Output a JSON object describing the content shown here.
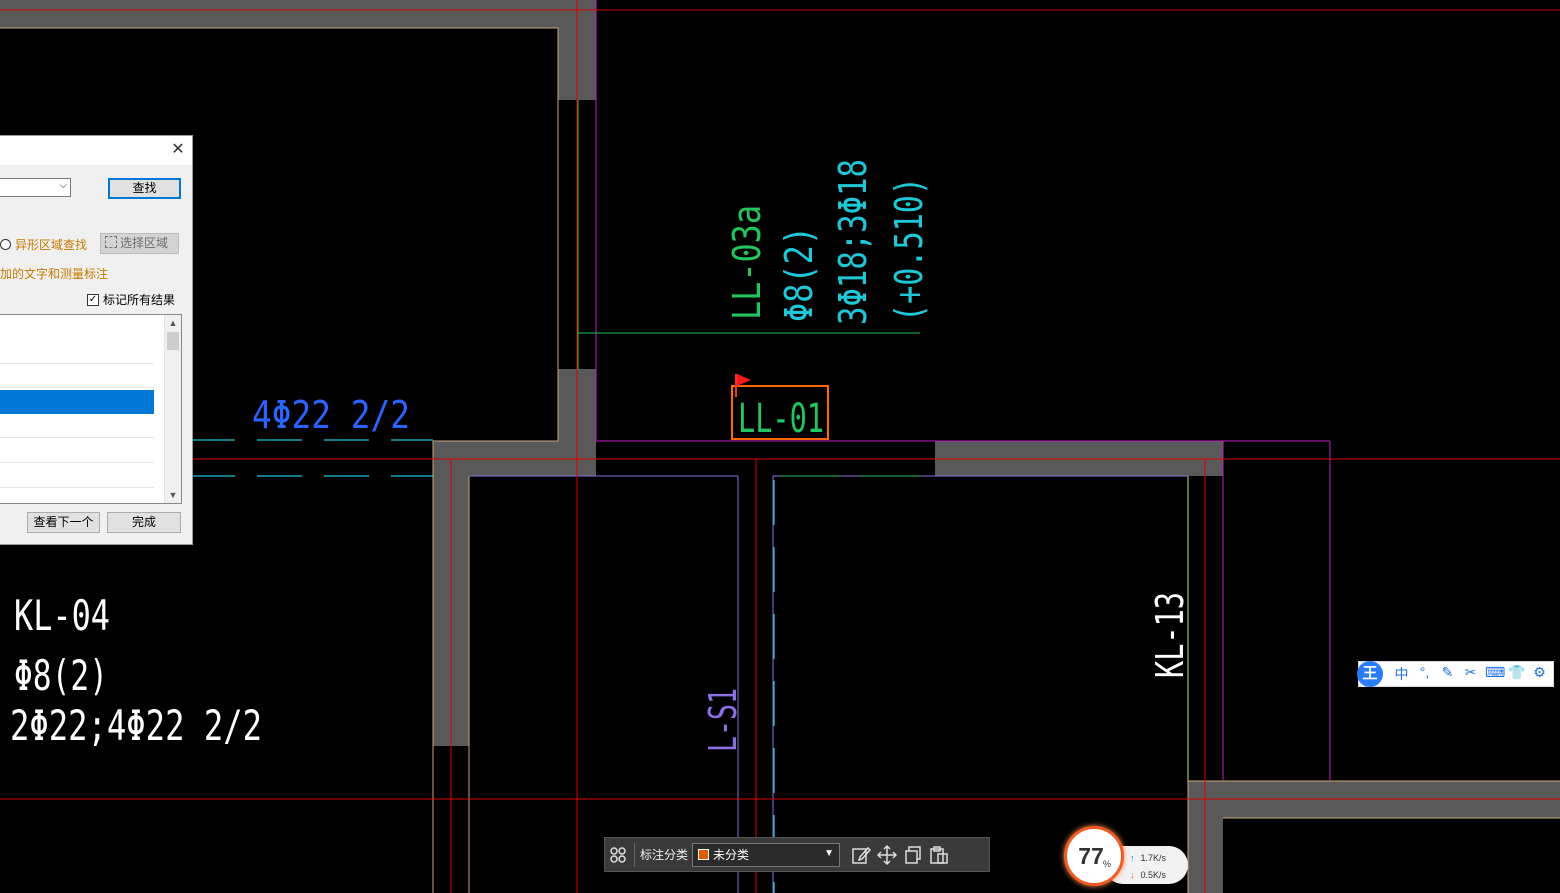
{
  "drawing": {
    "label_ll03a": "LL-03a",
    "label_ll03a_stirrup": "Φ8(2)",
    "label_ll03a_bars": "3Φ18;3Φ18",
    "label_ll03a_elev": "(+0.510)",
    "label_ll01": "LL-01",
    "label_4phi22": "4Φ22 2/2",
    "label_kl04": "KL-04",
    "label_kl04_stirrup": "Φ8(2)",
    "label_kl04_bars": "2Φ22;4Φ22 2/2",
    "label_ls1": "L-S1",
    "label_kl13": "KL-13"
  },
  "find_dialog": {
    "close_symbol": "✕",
    "find_button": "查找",
    "irregular_area_label": "异形区域查找",
    "select_area_button": "选择区域",
    "hint_text": "加的文字和测量标注",
    "mark_all_label": "标记所有结果",
    "mark_all_checked": true,
    "next_button": "查看下一个",
    "done_button": "完成"
  },
  "toolbar": {
    "category_label": "标注分类",
    "category_value": "未分类",
    "category_color": "#e05a00",
    "icons": [
      "grid-icon",
      "edit-icon",
      "move-icon",
      "copy-icon",
      "paste-icon"
    ]
  },
  "ime": {
    "logo": "王",
    "mode": "中",
    "punct": "°,",
    "colors": {
      "accent": "#1f6fe5"
    }
  },
  "network": {
    "percent": "77",
    "percent_sign": "%",
    "upload": "1.7K/s",
    "download": "0.5K/s"
  }
}
